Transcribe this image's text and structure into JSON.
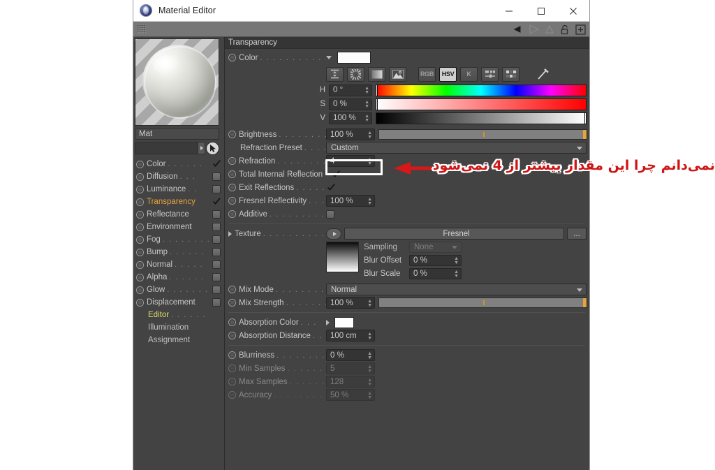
{
  "window": {
    "title": "Material Editor",
    "app_icon": "material-sphere-icon",
    "minimize_label": "−",
    "maximize_label": "□",
    "close_label": "✕"
  },
  "toolbar": {
    "grip_icon": "dot-grid-handle-icon",
    "icons": [
      "back-arrow-icon",
      "forward-arrow-icon",
      "up-arrow-icon",
      "lock-open-icon",
      "add-panel-icon"
    ]
  },
  "left_panel": {
    "preview_name": "material-preview-sphere",
    "material_name": "Mat",
    "material_selector_value": "",
    "cursor_icon": "pointer-icon",
    "channels": [
      {
        "label": "Color",
        "dots": ". . . . . .",
        "state": "checked",
        "style": "normal"
      },
      {
        "label": "Diffusion",
        "dots": ". . .",
        "state": "box",
        "style": "normal"
      },
      {
        "label": "Luminance",
        "dots": ". .",
        "state": "box",
        "style": "normal"
      },
      {
        "label": "Transparency",
        "dots": "",
        "state": "checked",
        "style": "active"
      },
      {
        "label": "Reflectance",
        "dots": "",
        "state": "box",
        "style": "normal"
      },
      {
        "label": "Environment",
        "dots": "",
        "state": "box",
        "style": "normal"
      },
      {
        "label": "Fog",
        "dots": ". . . . . . . .",
        "state": "box",
        "style": "normal"
      },
      {
        "label": "Bump",
        "dots": ". . . . . .",
        "state": "box",
        "style": "normal"
      },
      {
        "label": "Normal",
        "dots": ". . . . .",
        "state": "box",
        "style": "normal"
      },
      {
        "label": "Alpha",
        "dots": ". . . . . .",
        "state": "box",
        "style": "normal"
      },
      {
        "label": "Glow",
        "dots": ". . . . . . .",
        "state": "box",
        "style": "normal"
      },
      {
        "label": "Displacement",
        "dots": "",
        "state": "box",
        "style": "normal"
      }
    ],
    "sub_items": [
      {
        "label": "Editor",
        "dots": ". . . . . .",
        "style": "editor"
      },
      {
        "label": "Illumination",
        "dots": "",
        "style": "plain"
      },
      {
        "label": "Assignment",
        "dots": "",
        "style": "plain"
      }
    ]
  },
  "main": {
    "section_title": "Transparency",
    "color": {
      "label": "Color",
      "dots": ". . . . . . . . . . . .",
      "swatch_hex": "#fdfdfd",
      "mode_buttons": [
        {
          "name": "range-icon",
          "text": "",
          "active": false
        },
        {
          "name": "wheel-icon",
          "text": "",
          "active": false
        },
        {
          "name": "gradient-icon",
          "text": "",
          "active": false
        },
        {
          "name": "picture-icon",
          "text": "",
          "active": false
        },
        {
          "name": "rgb-button",
          "text": "RGB",
          "active": false
        },
        {
          "name": "hsv-button",
          "text": "HSV",
          "active": true
        },
        {
          "name": "kelvin-button",
          "text": "K",
          "active": false
        },
        {
          "name": "sliders-icon",
          "text": "",
          "active": false
        },
        {
          "name": "swatches-icon",
          "text": "",
          "active": false
        },
        {
          "name": "eyedropper-icon",
          "text": "",
          "active": false
        }
      ],
      "hsv": [
        {
          "channel": "H",
          "value": "0 °",
          "marker_pct": 0
        },
        {
          "channel": "S",
          "value": "0 %",
          "marker_pct": 0
        },
        {
          "channel": "V",
          "value": "100 %",
          "marker_pct": 100
        }
      ]
    },
    "brightness": {
      "label": "Brightness",
      "dots": ". . . . . . . . . .",
      "value": "100 %",
      "slider_pct": 100,
      "tick_pct": 50
    },
    "refraction_preset": {
      "label": "Refraction Preset",
      "dots": ". . . . . .",
      "value": "Custom"
    },
    "refraction": {
      "label": "Refraction",
      "dots": ". . . . . . . . . .",
      "value": "4"
    },
    "total_internal_reflection": {
      "label": "Total Internal Reflection",
      "dots": "",
      "checked": true
    },
    "exit_reflections": {
      "label": "Exit Reflections",
      "dots": ". . . . . . .",
      "checked": true
    },
    "fresnel_reflectivity": {
      "label": "Fresnel Reflectivity",
      "dots": ". . . .",
      "value": "100 %"
    },
    "additive": {
      "label": "Additive",
      "dots": ". . . . . . . . . . . .",
      "checked": false
    },
    "texture": {
      "label": "Texture",
      "dots": ". . . . . . . . . . . .",
      "value": "Fresnel",
      "more_label": "...",
      "play_icon": "play-arrow-icon",
      "thumb_name": "texture-thumbnail",
      "sampling_label": "Sampling",
      "sampling_value": "None",
      "blur_offset_label": "Blur Offset",
      "blur_offset_value": "0 %",
      "blur_scale_label": "Blur Scale",
      "blur_scale_value": "0 %"
    },
    "mix_mode": {
      "label": "Mix Mode",
      "dots": ". . . . . . . . . .",
      "value": "Normal"
    },
    "mix_strength": {
      "label": "Mix Strength",
      "dots": ". . . . . . . . .",
      "value": "100 %",
      "slider_pct": 100,
      "tick_pct": 50
    },
    "absorption_color": {
      "label": "Absorption Color",
      "dots": ". . .",
      "swatch_hex": "#ffffff"
    },
    "absorption_distance": {
      "label": "Absorption Distance",
      "dots": ". . .",
      "value": "100 cm"
    },
    "blurriness": {
      "label": "Blurriness",
      "dots": ". . . . . . . . . .",
      "value": "0 %",
      "disabled": false
    },
    "min_samples": {
      "label": "Min Samples",
      "dots": ". . . . . . . . .",
      "value": "5",
      "disabled": true
    },
    "max_samples": {
      "label": "Max Samples",
      "dots": ". . . . . . . . .",
      "value": "128",
      "disabled": true
    },
    "accuracy": {
      "label": "Accuracy",
      "dots": ". . . . . . . . . . .",
      "value": "50 %",
      "disabled": true
    }
  },
  "annotation": {
    "text": "نمی‌دانم چرا این مقدار بیشتر از 4 نمی‌شود",
    "arrow_color": "#d81818",
    "highlight_color": "#ffffff"
  }
}
